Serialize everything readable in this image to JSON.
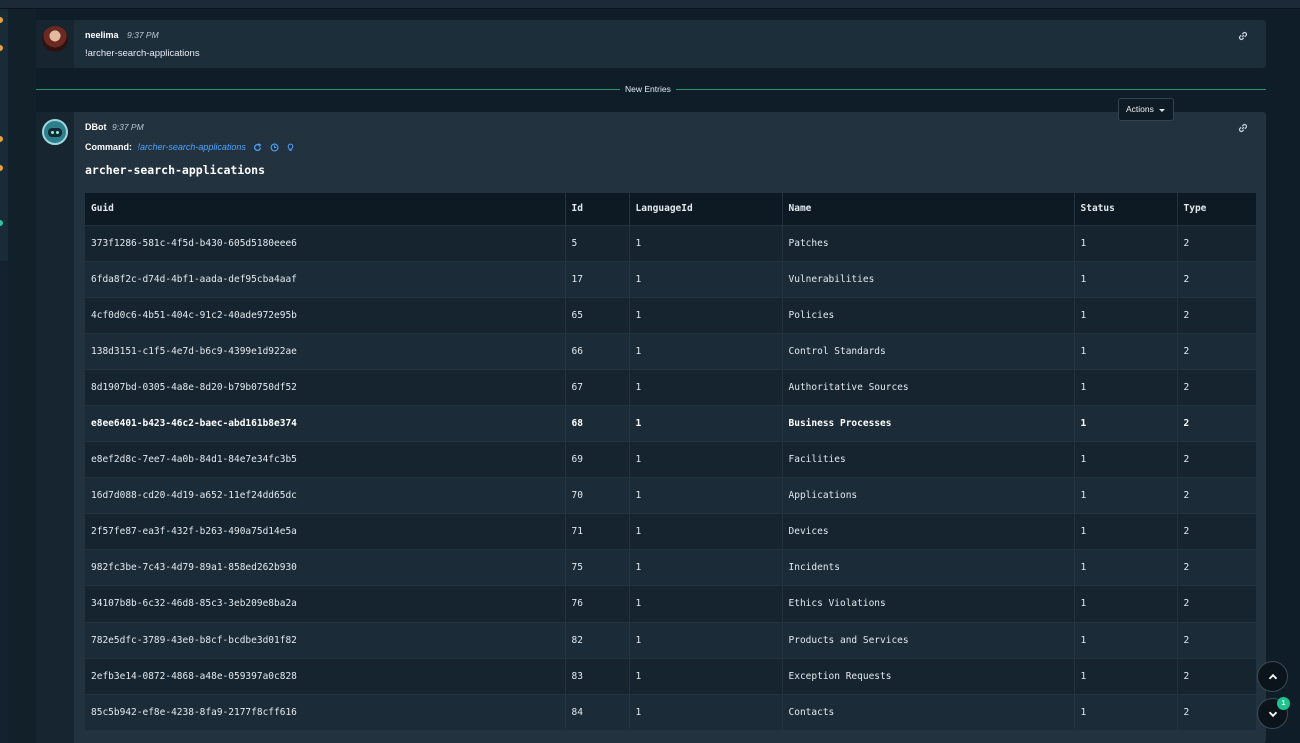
{
  "messages": [
    {
      "author": "neelima",
      "time": "9:37 PM",
      "text": "!archer-search-applications"
    },
    {
      "author": "DBot",
      "time": "9:37 PM",
      "command_label": "Command:",
      "command": "!archer-search-applications"
    }
  ],
  "divider": {
    "label": "New Entries"
  },
  "actions": {
    "label": "Actions"
  },
  "table": {
    "title": "archer-search-applications",
    "columns": [
      "Guid",
      "Id",
      "LanguageId",
      "Name",
      "Status",
      "Type"
    ],
    "rows": [
      [
        "373f1286-581c-4f5d-b430-605d5180eee6",
        "5",
        "1",
        "Patches",
        "1",
        "2"
      ],
      [
        "6fda8f2c-d74d-4bf1-aada-def95cba4aaf",
        "17",
        "1",
        "Vulnerabilities",
        "1",
        "2"
      ],
      [
        "4cf0d0c6-4b51-404c-91c2-40ade972e95b",
        "65",
        "1",
        "Policies",
        "1",
        "2"
      ],
      [
        "138d3151-c1f5-4e7d-b6c9-4399e1d922ae",
        "66",
        "1",
        "Control Standards",
        "1",
        "2"
      ],
      [
        "8d1907bd-0305-4a8e-8d20-b79b0750df52",
        "67",
        "1",
        "Authoritative Sources",
        "1",
        "2"
      ],
      [
        "e8ee6401-b423-46c2-baec-abd161b8e374",
        "68",
        "1",
        "Business Processes",
        "1",
        "2"
      ],
      [
        "e8ef2d8c-7ee7-4a0b-84d1-84e7e34fc3b5",
        "69",
        "1",
        "Facilities",
        "1",
        "2"
      ],
      [
        "16d7d088-cd20-4d19-a652-11ef24dd65dc",
        "70",
        "1",
        "Applications",
        "1",
        "2"
      ],
      [
        "2f57fe87-ea3f-432f-b263-490a75d14e5a",
        "71",
        "1",
        "Devices",
        "1",
        "2"
      ],
      [
        "982fc3be-7c43-4d79-89a1-858ed262b930",
        "75",
        "1",
        "Incidents",
        "1",
        "2"
      ],
      [
        "34107b8b-6c32-46d8-85c3-3eb209e8ba2a",
        "76",
        "1",
        "Ethics Violations",
        "1",
        "2"
      ],
      [
        "782e5dfc-3789-43e0-b8cf-bcdbe3d01f82",
        "82",
        "1",
        "Products and Services",
        "1",
        "2"
      ],
      [
        "2efb3e14-0872-4868-a48e-059397a0c828",
        "83",
        "1",
        "Exception Requests",
        "1",
        "2"
      ],
      [
        "85c5b942-ef8e-4238-8fa9-2177f8cff616",
        "84",
        "1",
        "Contacts",
        "1",
        "2"
      ]
    ]
  },
  "notifications": {
    "count": "1"
  },
  "icons": {
    "link": "link-icon",
    "rerun": "refresh-icon",
    "clock": "clock-icon",
    "hint": "lightbulb-icon",
    "scroll_up": "chevron-up-icon",
    "scroll_down": "chevron-down-icon"
  },
  "colors": {
    "accent": "#2ec27e",
    "command": "#4da3ff",
    "badge": "#1ec28b",
    "header_bg": "#0d1923"
  }
}
